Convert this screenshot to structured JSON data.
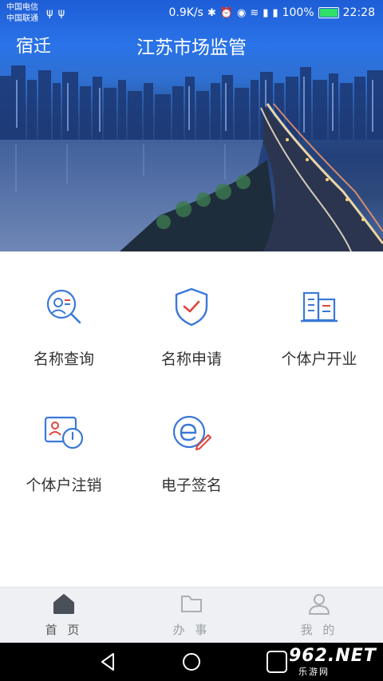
{
  "status_bar": {
    "carrier1": "中国电信",
    "carrier2": "中国联通",
    "speed": "0.9K/s",
    "battery": "100%",
    "time": "22:28"
  },
  "header": {
    "city": "宿迁",
    "title": "江苏市场监管"
  },
  "services": [
    {
      "label": "名称查询",
      "icon": "name-search-icon"
    },
    {
      "label": "名称申请",
      "icon": "shield-check-icon"
    },
    {
      "label": "个体户开业",
      "icon": "buildings-icon"
    },
    {
      "label": "个体户注销",
      "icon": "id-power-icon"
    },
    {
      "label": "电子签名",
      "icon": "e-sign-icon"
    }
  ],
  "tabs": [
    {
      "label": "首 页",
      "icon": "home-icon",
      "active": true
    },
    {
      "label": "办 事",
      "icon": "folder-icon",
      "active": false
    },
    {
      "label": "我 的",
      "icon": "user-icon",
      "active": false
    }
  ],
  "watermark": {
    "brand": "962.NET",
    "sub": "乐游网"
  },
  "colors": {
    "accent": "#3a78d8",
    "hero_top": "#1e5dd6",
    "tab_active": "#4a4f5a",
    "tab_inactive": "#a9afb7",
    "battery": "#2ee06a"
  }
}
